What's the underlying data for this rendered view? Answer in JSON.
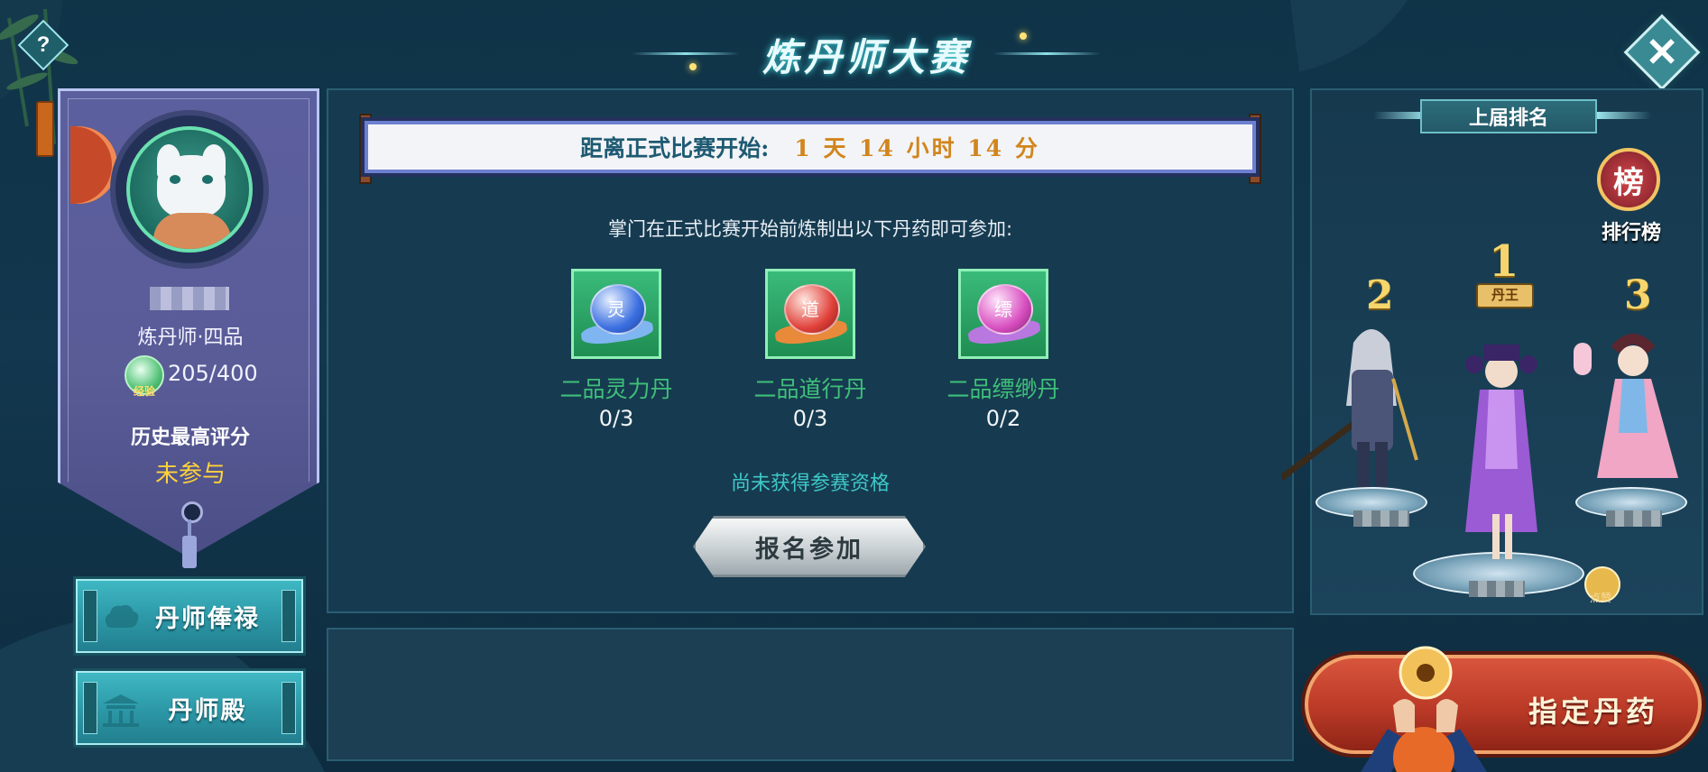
{
  "header": {
    "title": "炼丹师大赛"
  },
  "help": {
    "icon": "question-mark-icon",
    "label": "?"
  },
  "close": {
    "icon": "close-icon",
    "label": "✕"
  },
  "player": {
    "rank": "炼丹师·四品",
    "exp_icon_text": "经验",
    "exp": "205/400",
    "best_label": "历史最高评分",
    "best_value": "未参与"
  },
  "side_buttons": [
    {
      "label": "丹师俸禄",
      "icon": "cloud-icon"
    },
    {
      "label": "丹师殿",
      "icon": "temple-icon"
    }
  ],
  "countdown": {
    "label": "距离正式比赛开始:",
    "value": "1 天 14 小时 14 分"
  },
  "instruction": "掌门在正式比赛开始前炼制出以下丹药即可参加:",
  "pills": [
    {
      "name": "二品灵力丹",
      "count": "0/3",
      "char": "灵",
      "color": "#3b6fe0",
      "cloth": "#7fb5f0"
    },
    {
      "name": "二品道行丹",
      "count": "0/3",
      "char": "道",
      "color": "#e0423b",
      "cloth": "#e88a3a"
    },
    {
      "name": "二品缥缈丹",
      "count": "0/2",
      "char": "缥",
      "color": "#d84fc0",
      "cloth": "#b878e0"
    }
  ],
  "status": "尚未获得参赛资格",
  "signup": {
    "label": "报名参加"
  },
  "ranking": {
    "header": "上届排名",
    "board_icon_char": "榜",
    "board_label": "排行榜",
    "first_num": "1",
    "first_tag": "丹王",
    "second_num": "2",
    "third_num": "3",
    "like_label": "点赞"
  },
  "designate": {
    "label": "指定丹药"
  },
  "colors": {
    "accent": "#3fc7c7",
    "gold": "#d1851c",
    "green": "#3fbf7a",
    "brand_red": "#bb3a27"
  }
}
